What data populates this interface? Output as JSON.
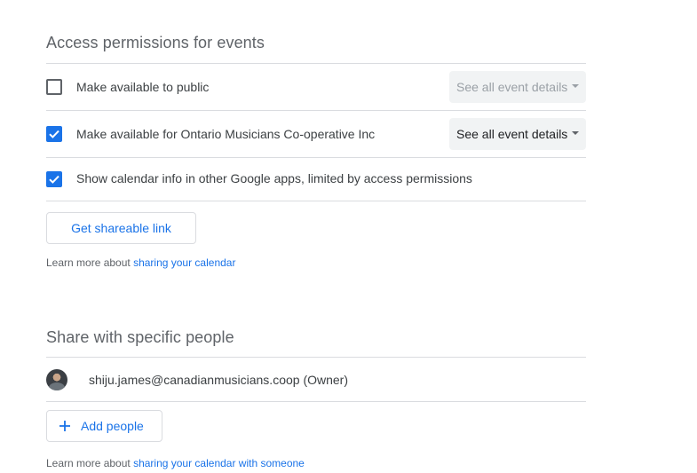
{
  "access": {
    "title": "Access permissions for events",
    "rows": [
      {
        "label": "Make available to public",
        "checked": false,
        "select": "See all event details",
        "select_enabled": false
      },
      {
        "label": "Make available for Ontario Musicians Co-operative Inc",
        "checked": true,
        "select": "See all event details",
        "select_enabled": true
      },
      {
        "label": "Show calendar info in other Google apps, limited by access permissions",
        "checked": true
      }
    ],
    "shareable_link_label": "Get shareable link",
    "learn_prefix": "Learn more about ",
    "learn_link": "sharing your calendar"
  },
  "share": {
    "title": "Share with specific people",
    "person": {
      "email": "shiju.james@canadianmusicians.coop (Owner)"
    },
    "add_people_label": "Add people",
    "learn_prefix": "Learn more about ",
    "learn_link": "sharing your calendar with someone"
  },
  "colors": {
    "accent": "#1a73e8",
    "divider": "#dadce0",
    "text": "#3c4043"
  },
  "icons": {
    "check": "check-icon",
    "add": "plus-icon",
    "dropdown": "caret-down-icon"
  }
}
